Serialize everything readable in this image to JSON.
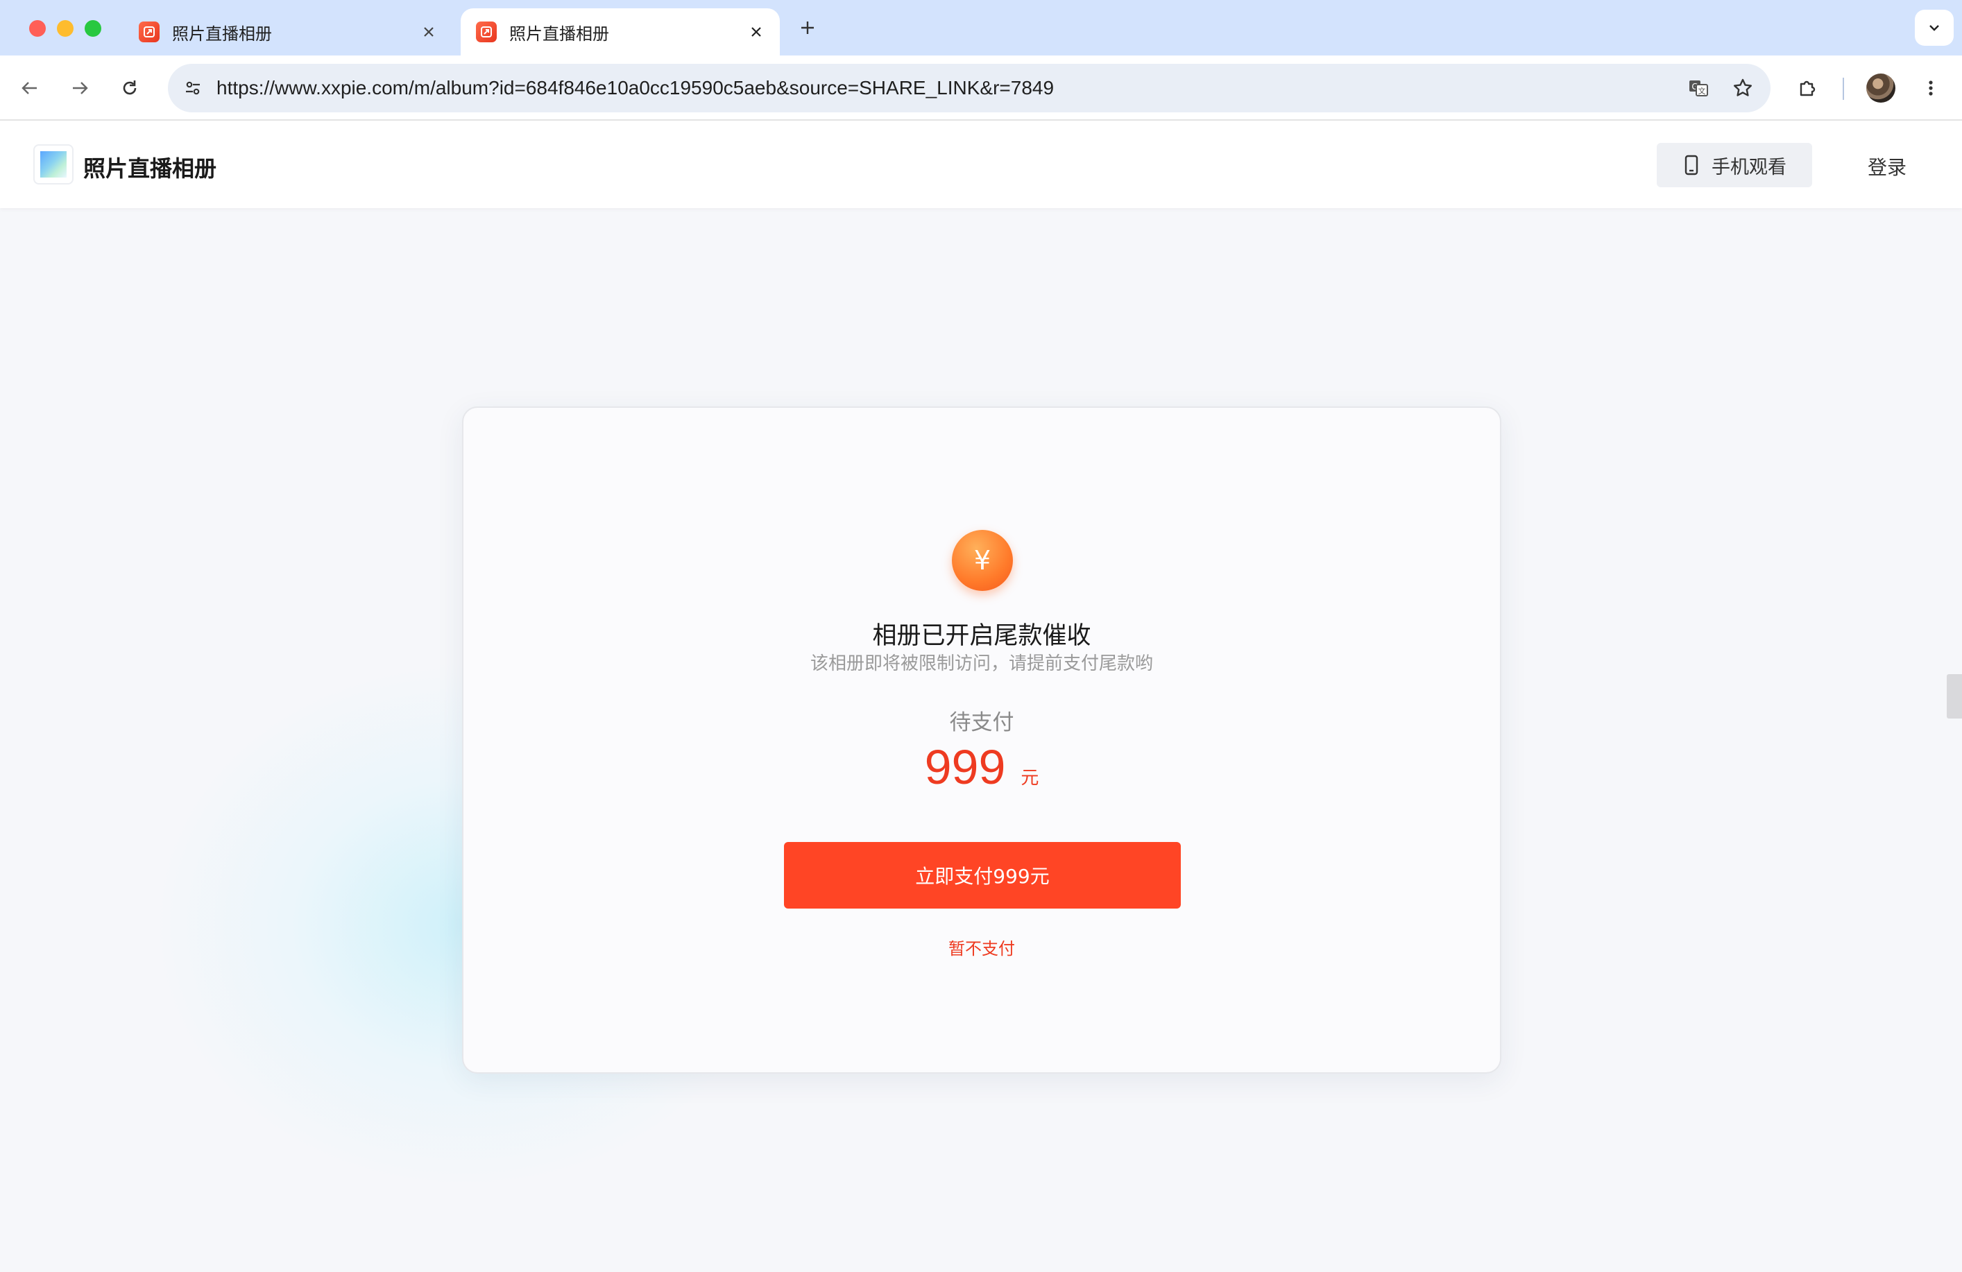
{
  "browser": {
    "tabs": [
      {
        "title": "照片直播相册",
        "active": false
      },
      {
        "title": "照片直播相册",
        "active": true
      }
    ],
    "url": "https://www.xxpie.com/m/album?id=684f846e10a0cc19590c5aeb&source=SHARE_LINK&r=7849",
    "icons": {
      "back": "arrow-left-icon",
      "forward": "arrow-right-icon",
      "reload": "reload-icon",
      "site_info": "tune-icon",
      "translate": "translate-icon",
      "bookmark": "star-icon",
      "extensions": "puzzle-icon",
      "menu": "more-vertical-icon"
    }
  },
  "header": {
    "site_title": "照片直播相册",
    "mobile_button_label": "手机观看",
    "login_label": "登录"
  },
  "card": {
    "coin_symbol": "¥",
    "title": "相册已开启尾款催收",
    "subtitle": "该相册即将被限制访问，请提前支付尾款哟",
    "pending_label": "待支付",
    "amount": "999",
    "unit": "元",
    "pay_button_label": "立即支付999元",
    "skip_label": "暂不支付"
  },
  "colors": {
    "accent": "#ff4525",
    "amount_text": "#ee3b21",
    "tabstrip_bg": "#d3e3fd",
    "omnibox_bg": "#e9eef6"
  }
}
